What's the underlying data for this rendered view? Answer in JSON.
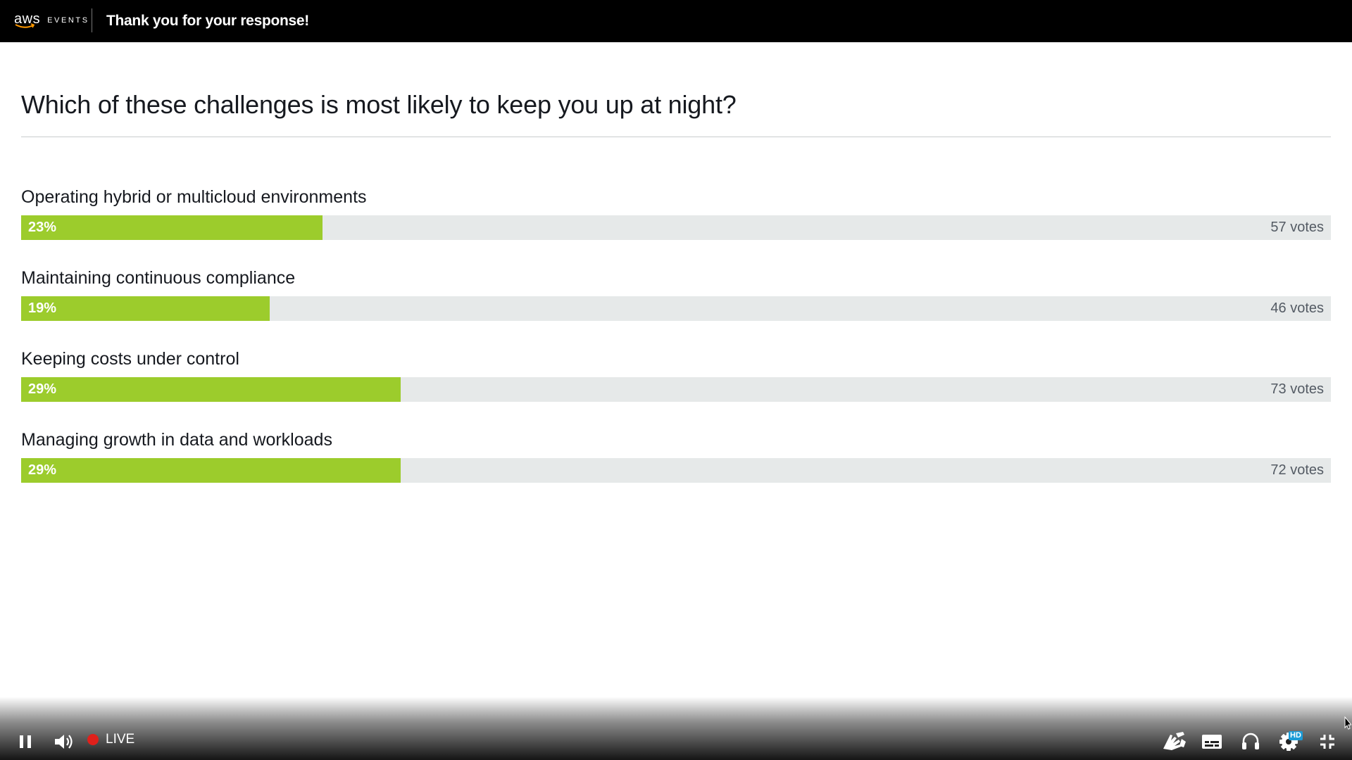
{
  "header": {
    "logo_text": "aws",
    "logo_sub": "EVENTS",
    "title": "Thank you for your response!"
  },
  "poll": {
    "question": "Which of these challenges is most likely to keep you up at night?",
    "options": [
      {
        "label": "Operating hybrid or multicloud environments",
        "percent": "23%",
        "fill_fraction": 0.23,
        "votes": "57 votes"
      },
      {
        "label": "Maintaining continuous compliance",
        "percent": "19%",
        "fill_fraction": 0.19,
        "votes": "46 votes"
      },
      {
        "label": "Keeping costs under control",
        "percent": "29%",
        "fill_fraction": 0.29,
        "votes": "73 votes"
      },
      {
        "label": "Managing growth in data and workloads",
        "percent": "29%",
        "fill_fraction": 0.29,
        "votes": "72 votes"
      }
    ]
  },
  "player": {
    "live_label": "LIVE",
    "hd_badge": "HD",
    "icons": [
      "pause-icon",
      "volume-icon",
      "live-dot-icon",
      "sign-language-icon",
      "captions-icon",
      "audio-track-icon",
      "settings-icon",
      "exit-fullscreen-icon"
    ]
  },
  "colors": {
    "bar_fill": "#9ccc2c",
    "bar_track": "#e6e9e9",
    "live_dot": "#e0201b",
    "hd_badge": "#1a9bd7"
  }
}
